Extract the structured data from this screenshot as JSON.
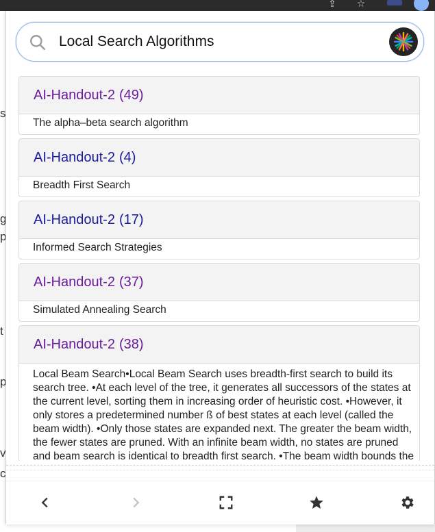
{
  "search": {
    "query": "Local Search Algorithms"
  },
  "results": [
    {
      "title": "AI-Handout-2",
      "count": "(49)",
      "snippet": "The alpha–beta search algorithm",
      "visited": true
    },
    {
      "title": "AI-Handout-2",
      "count": "(4)",
      "snippet": "Breadth First Search",
      "visited": false
    },
    {
      "title": "AI-Handout-2",
      "count": "(17)",
      "snippet": "Informed Search Strategies",
      "visited": false
    },
    {
      "title": "AI-Handout-2",
      "count": "(37)",
      "snippet": "Simulated Annealing Search",
      "visited": true
    },
    {
      "title": "AI-Handout-2",
      "count": "(38)",
      "snippet": "Local Beam Search•Local Beam Search uses breadth-first search to build its search tree. •At each level of the tree, it generates all successors of the states at the current level, sorting them in increasing order of heuristic cost. •However, it only stores a predetermined number ß of best states at each level (called the beam width). •Only those states are expanded next. The greater the beam width, the fewer states are pruned. With an infinite beam width, no states are pruned and beam search is identical to breadth first search. •The beam width bounds the memory required to perform the search.",
      "visited": true
    }
  ],
  "toolbar": {
    "back_icon": "chevron-left-icon",
    "forward_icon": "chevron-right-icon",
    "fullscreen_icon": "fullscreen-icon",
    "star_icon": "star-icon",
    "settings_icon": "gear-icon"
  },
  "colors": {
    "visited_link": "#6a1b9a",
    "unvisited_link": "#1a1a9a",
    "search_border": "#8ab4e0"
  }
}
